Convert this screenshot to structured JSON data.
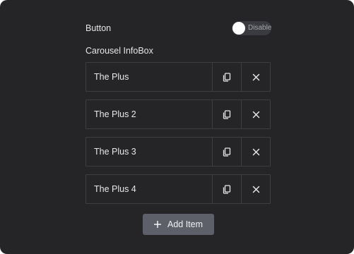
{
  "settings": {
    "button_label": "Button",
    "button_toggle_text": "Disable",
    "button_toggle_state": "off",
    "section_label": "Carousel InfoBox"
  },
  "items": [
    {
      "label": "The Plus"
    },
    {
      "label": "The Plus 2"
    },
    {
      "label": "The Plus 3"
    },
    {
      "label": "The Plus 4"
    }
  ],
  "actions": {
    "duplicate_icon": "copy-icon",
    "remove_icon": "close-icon"
  },
  "add_item": {
    "label": "Add Item",
    "icon": "plus-icon"
  },
  "colors": {
    "panel_background": "#252528",
    "button_background": "#5d6068",
    "border": "#3d3e42"
  }
}
